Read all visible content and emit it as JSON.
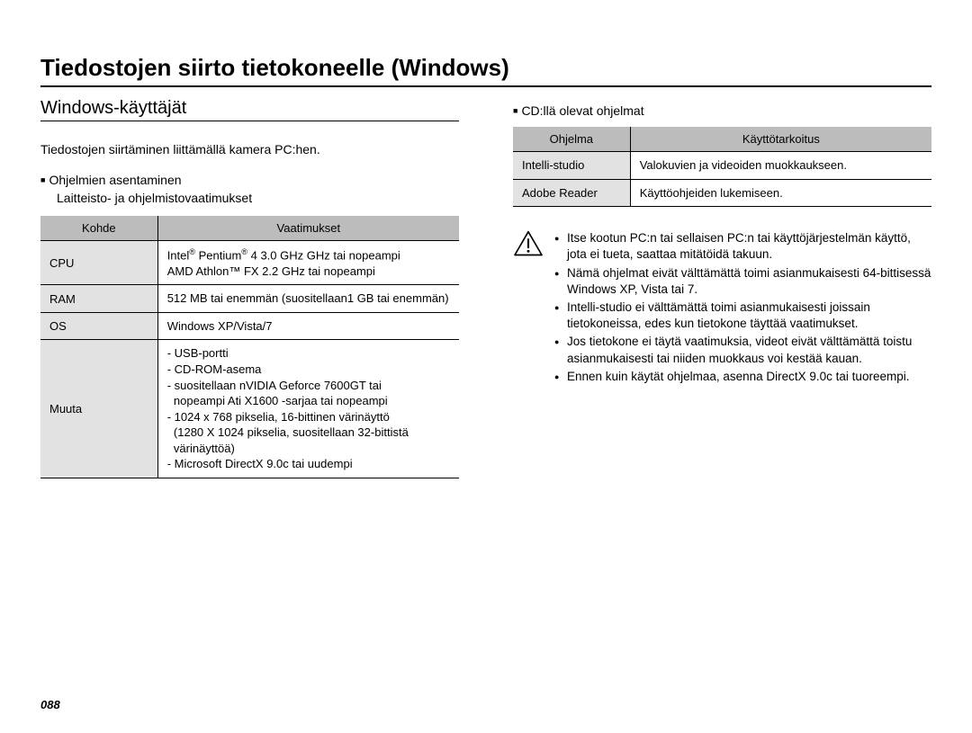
{
  "page_title": "Tiedostojen siirto tietokoneelle (Windows)",
  "page_number": "088",
  "left": {
    "subtitle": "Windows-käyttäjät",
    "intro": "Tiedostojen siirtäminen liittämällä kamera PC:hen.",
    "install_heading": "Ohjelmien asentaminen",
    "req_heading": "Laitteisto- ja ohjelmistovaatimukset",
    "table": {
      "head_key": "Kohde",
      "head_val": "Vaatimukset",
      "rows": [
        {
          "key": "CPU",
          "val_html": "Intel<sup>®</sup> Pentium<sup>®</sup> 4 3.0 GHz GHz tai nopeampi<br>AMD Athlon™ FX 2.2 GHz tai nopeampi"
        },
        {
          "key": "RAM",
          "val_html": "512 MB tai enemmän (suositellaan1 GB tai enemmän)"
        },
        {
          "key": "OS",
          "val_html": "Windows XP/Vista/7"
        },
        {
          "key": "Muuta",
          "val_html": "- USB-portti<br>- CD-ROM-asema<br>- suositellaan nVIDIA Geforce 7600GT tai<br>&nbsp;&nbsp;nopeampi Ati X1600 -sarjaa tai nopeampi<br>- 1024 x 768 pikselia, 16-bittinen värinäyttö<br>&nbsp;&nbsp;(1280 X 1024 pikselia, suositellaan 32-bittistä<br>&nbsp;&nbsp;värinäyttöä)<br>- Microsoft DirectX 9.0c tai uudempi"
        }
      ]
    }
  },
  "right": {
    "cd_heading": "CD:llä olevat ohjelmat",
    "cd_table": {
      "head_key": "Ohjelma",
      "head_val": "Käyttötarkoitus",
      "rows": [
        {
          "key": "Intelli-studio",
          "val": "Valokuvien ja videoiden muokkaukseen."
        },
        {
          "key": "Adobe Reader",
          "val": "Käyttöohjeiden lukemiseen."
        }
      ]
    },
    "warnings": [
      "Itse kootun PC:n tai sellaisen PC:n tai käyttöjärjestelmän käyttö, jota ei tueta, saattaa mitätöidä takuun.",
      "Nämä ohjelmat eivät välttämättä toimi asianmukaisesti 64-bittisessä Windows XP, Vista tai 7.",
      "Intelli-studio ei välttämättä toimi asianmukaisesti joissain tietokoneissa, edes kun tietokone täyttää vaatimukset.",
      "Jos tietokone ei täytä vaatimuksia, videot eivät välttämättä toistu asianmukaisesti tai niiden muokkaus voi kestää kauan.",
      "Ennen kuin käytät ohjelmaa, asenna DirectX 9.0c tai tuoreempi."
    ]
  }
}
